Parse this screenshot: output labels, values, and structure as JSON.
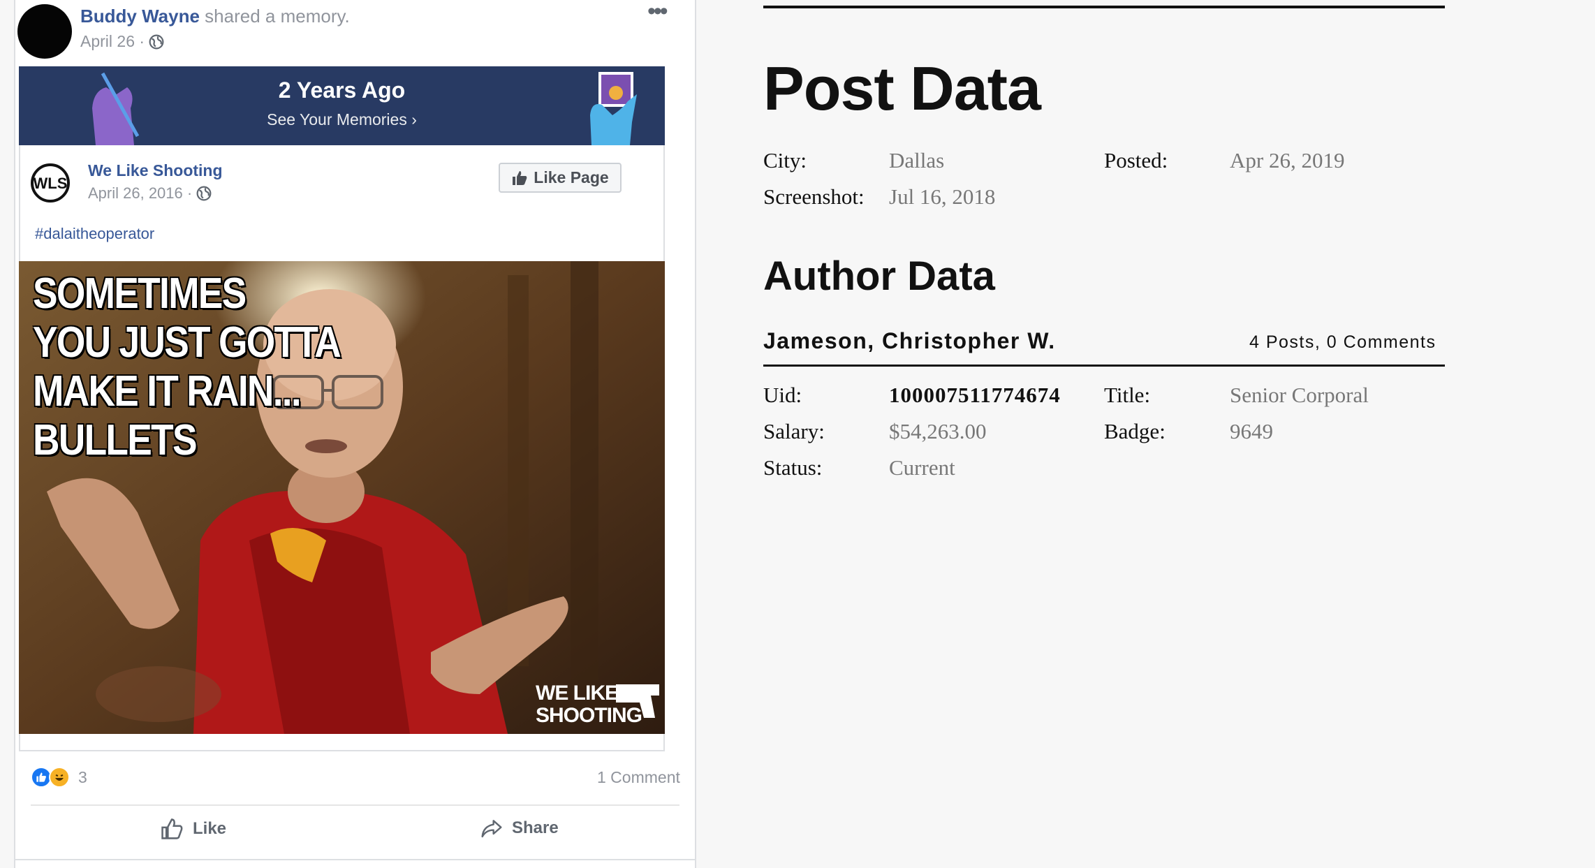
{
  "post": {
    "poster_name": "Buddy Wayne",
    "action_text": " shared a memory.",
    "date": "April 26 ·",
    "more_icon": "more-horizontal-icon"
  },
  "memory_banner": {
    "title": "2 Years Ago",
    "link": "See Your Memories ›",
    "background": "#283a63"
  },
  "shared_post": {
    "page_name": "We Like Shooting",
    "date": "April 26, 2016 ·",
    "like_page_label": "Like Page",
    "hashtag": "#dalaitheoperator",
    "meme_text": "SOMETIMES\nYOU JUST GOTTA\nMAKE IT RAIN...\nBULLETS",
    "watermark_lines": [
      "WE LIKE",
      "SHOOTING"
    ]
  },
  "reactions": {
    "count": "3",
    "comments": "1 Comment"
  },
  "actions": {
    "like": "Like",
    "share": "Share"
  },
  "post_data": {
    "heading": "Post Data",
    "city_label": "City:",
    "city": "Dallas",
    "posted_label": "Posted:",
    "posted": "Apr 26, 2019",
    "screenshot_label": "Screenshot:",
    "screenshot": "Jul 16, 2018"
  },
  "author_data": {
    "heading": "Author Data",
    "name": "Jameson, Christopher W.",
    "stats": "4 Posts, 0 Comments",
    "uid_label": "Uid:",
    "uid": "100007511774674",
    "title_label": "Title:",
    "title": "Senior Corporal",
    "salary_label": "Salary:",
    "salary": "$54,263.00",
    "badge_label": "Badge:",
    "badge": "9649",
    "status_label": "Status:",
    "status": "Current"
  },
  "colors": {
    "fb_link": "#385898",
    "fb_meta": "#90949c",
    "like_blue": "#1877f2",
    "haha_yellow": "#f7b125"
  }
}
